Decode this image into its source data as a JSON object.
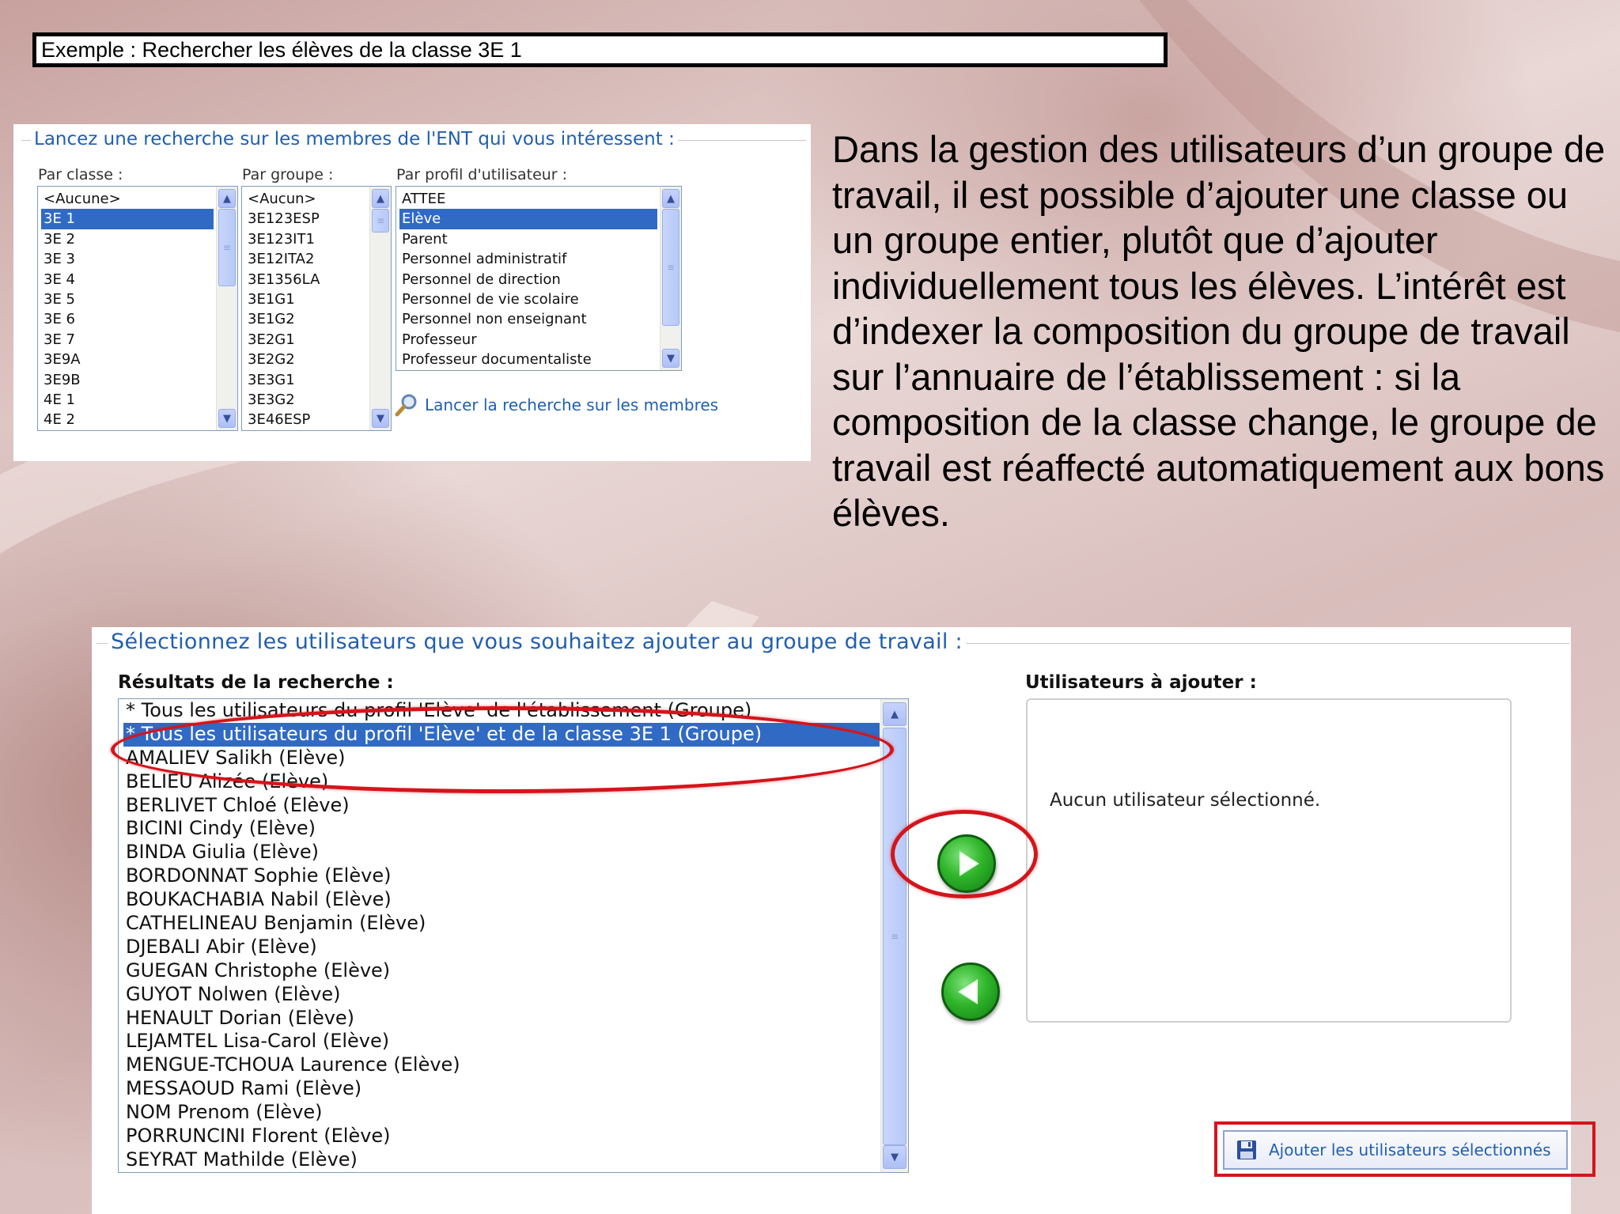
{
  "title": "Exemple : Rechercher les élèves de la classe 3E 1",
  "search_panel": {
    "legend": "Lancez une recherche sur les membres de l'ENT qui vous intéressent :",
    "par_classe": {
      "label": "Par classe :",
      "items": [
        "<Aucune>",
        "3E 1",
        "3E 2",
        "3E 3",
        "3E 4",
        "3E 5",
        "3E 6",
        "3E 7",
        "3E9A",
        "3E9B",
        "4E 1",
        "4E 2"
      ],
      "selected_index": 1
    },
    "par_groupe": {
      "label": "Par groupe :",
      "items": [
        "<Aucun>",
        "3E123ESP",
        "3E123IT1",
        "3E12ITA2",
        "3E1356LA",
        "3E1G1",
        "3E1G2",
        "3E2G1",
        "3E2G2",
        "3E3G1",
        "3E3G2",
        "3E46ESP"
      ],
      "selected_index": -1
    },
    "par_profil": {
      "label": "Par profil d'utilisateur :",
      "items": [
        "ATTEE",
        "Elève",
        "Parent",
        "Personnel administratif",
        "Personnel de direction",
        "Personnel de vie scolaire",
        "Personnel non enseignant",
        "Professeur",
        "Professeur documentaliste"
      ],
      "selected_index": 1
    },
    "search_link": "Lancer la recherche sur les membres",
    "search_icon": "magnifier-icon"
  },
  "explanation": "Dans la gestion des utilisateurs d’un groupe de travail, il est possible d’ajouter une classe ou un groupe entier, plutôt que d’ajouter individuellement tous les élèves. L’intérêt est d’indexer la composition du groupe de travail sur l’annuaire de l’établissement : si la composition de la classe change, le groupe de travail est réaffecté automatiquement aux bons élèves.",
  "select_panel": {
    "legend": "Sélectionnez les utilisateurs que vous souhaitez ajouter au groupe de travail :",
    "results": {
      "label": "Résultats de la recherche :",
      "items": [
        "* Tous les utilisateurs du profil 'Elève' de l'établissement (Groupe)",
        "* Tous les utilisateurs du profil 'Elève' et de la classe 3E 1 (Groupe)",
        "AMALIEV Salikh (Elève)",
        "BELIEU Alizée (Elève)",
        "BERLIVET Chloé (Elève)",
        "BICINI Cindy (Elève)",
        "BINDA Giulia (Elève)",
        "BORDONNAT Sophie (Elève)",
        "BOUKACHABIA Nabil (Elève)",
        "CATHELINEAU Benjamin (Elève)",
        "DJEBALI Abir (Elève)",
        "GUEGAN Christophe (Elève)",
        "GUYOT Nolwen (Elève)",
        "HENAULT Dorian (Elève)",
        "LEJAMTEL Lisa-Carol (Elève)",
        "MENGUE-TCHOUA Laurence (Elève)",
        "MESSAOUD Rami (Elève)",
        "NOM Prenom (Elève)",
        "PORRUNCINI Florent (Elève)",
        "SEYRAT Mathilde (Elève)"
      ],
      "selected_index": 1
    },
    "to_add": {
      "label": "Utilisateurs à ajouter :",
      "empty_text": "Aucun utilisateur sélectionné."
    },
    "add_arrow_icon": "arrow-right-icon",
    "remove_arrow_icon": "arrow-left-icon",
    "add_button": {
      "label": "Ajouter les utilisateurs sélectionnés",
      "icon": "floppy-disk-icon"
    }
  },
  "colors": {
    "accent_blue": "#1f5fb3",
    "selection_blue": "#316ac5",
    "highlight_red": "#d4151b",
    "arrow_green": "#2fb52a"
  }
}
